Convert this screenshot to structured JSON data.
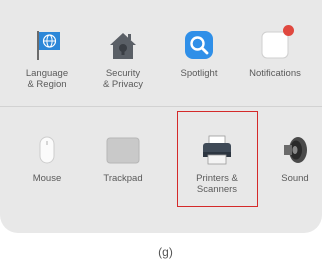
{
  "panes": {
    "row1": [
      {
        "label": "Language\n& Region",
        "icon": "flag-icon"
      },
      {
        "label": "Security\n& Privacy",
        "icon": "house-lock-icon"
      },
      {
        "label": "Spotlight",
        "icon": "spotlight-icon"
      },
      {
        "label": "Notifications",
        "icon": "notifications-icon"
      }
    ],
    "row2": [
      {
        "label": "Mouse",
        "icon": "mouse-icon"
      },
      {
        "label": "Trackpad",
        "icon": "trackpad-icon"
      },
      {
        "label": "Printers &\nScanners",
        "icon": "printer-icon"
      },
      {
        "label": "Sound",
        "icon": "speaker-icon"
      }
    ]
  },
  "caption": "(g)",
  "colors": {
    "highlight": "#d42a2a",
    "panel": "#e8e8e8"
  }
}
